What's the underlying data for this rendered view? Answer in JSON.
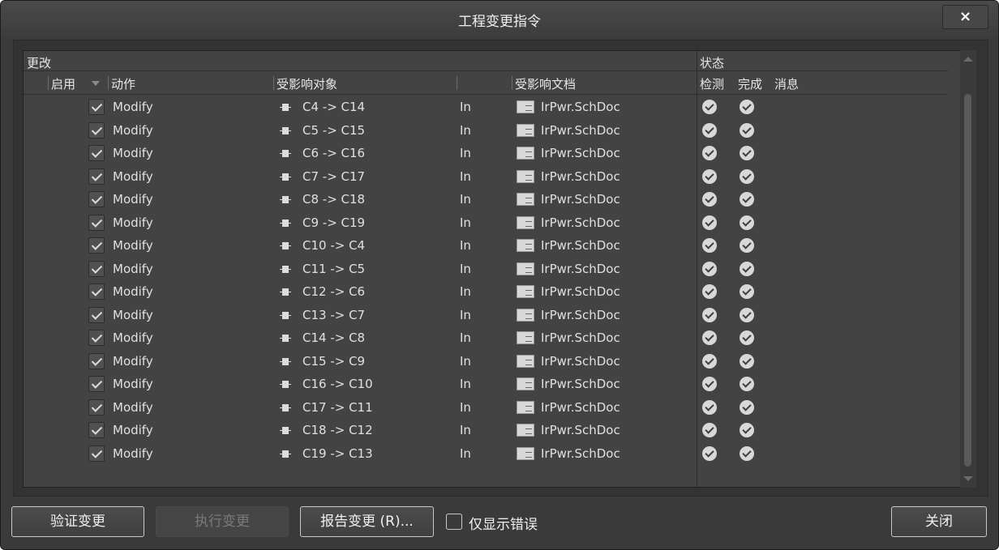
{
  "window": {
    "title": "工程变更指令",
    "close_glyph": "×"
  },
  "grid": {
    "group_headers": {
      "change": "更改",
      "status": "状态"
    },
    "columns": {
      "enabled": "启用",
      "action": "动作",
      "affected_object": "受影响对象",
      "affected_document": "受影响文档",
      "check": "检测",
      "done": "完成",
      "message": "消息"
    },
    "rows": [
      {
        "action": "Modify",
        "object": "C4 -> C14",
        "in": "In",
        "document": "IrPwr.SchDoc"
      },
      {
        "action": "Modify",
        "object": "C5 -> C15",
        "in": "In",
        "document": "IrPwr.SchDoc"
      },
      {
        "action": "Modify",
        "object": "C6 -> C16",
        "in": "In",
        "document": "IrPwr.SchDoc"
      },
      {
        "action": "Modify",
        "object": "C7 -> C17",
        "in": "In",
        "document": "IrPwr.SchDoc"
      },
      {
        "action": "Modify",
        "object": "C8 -> C18",
        "in": "In",
        "document": "IrPwr.SchDoc"
      },
      {
        "action": "Modify",
        "object": "C9 -> C19",
        "in": "In",
        "document": "IrPwr.SchDoc"
      },
      {
        "action": "Modify",
        "object": "C10 -> C4",
        "in": "In",
        "document": "IrPwr.SchDoc"
      },
      {
        "action": "Modify",
        "object": "C11 -> C5",
        "in": "In",
        "document": "IrPwr.SchDoc"
      },
      {
        "action": "Modify",
        "object": "C12 -> C6",
        "in": "In",
        "document": "IrPwr.SchDoc"
      },
      {
        "action": "Modify",
        "object": "C13 -> C7",
        "in": "In",
        "document": "IrPwr.SchDoc"
      },
      {
        "action": "Modify",
        "object": "C14 -> C8",
        "in": "In",
        "document": "IrPwr.SchDoc"
      },
      {
        "action": "Modify",
        "object": "C15 -> C9",
        "in": "In",
        "document": "IrPwr.SchDoc"
      },
      {
        "action": "Modify",
        "object": "C16 -> C10",
        "in": "In",
        "document": "IrPwr.SchDoc"
      },
      {
        "action": "Modify",
        "object": "C17 -> C11",
        "in": "In",
        "document": "IrPwr.SchDoc"
      },
      {
        "action": "Modify",
        "object": "C18 -> C12",
        "in": "In",
        "document": "IrPwr.SchDoc"
      },
      {
        "action": "Modify",
        "object": "C19 -> C13",
        "in": "In",
        "document": "IrPwr.SchDoc"
      }
    ]
  },
  "footer": {
    "validate_label": "验证变更",
    "execute_label": "执行变更",
    "report_label": "报告变更 (R)...",
    "only_errors_label": "仅显示错误",
    "close_label": "关闭"
  }
}
